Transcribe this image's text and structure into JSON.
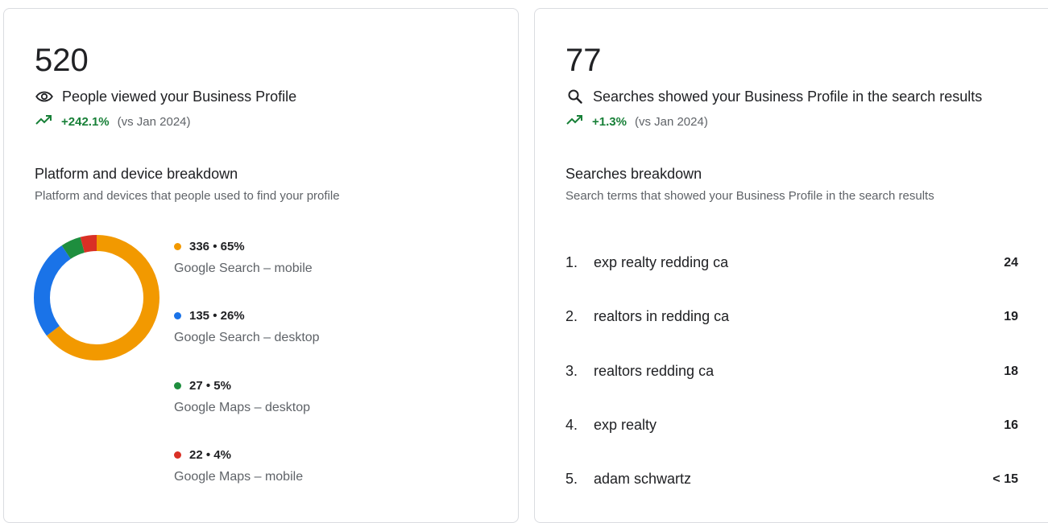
{
  "colors": {
    "mobile_search": "#F29900",
    "desktop_search": "#1A73E8",
    "maps_desktop": "#1E8E3E",
    "maps_mobile": "#D93025",
    "trend_up": "#188038"
  },
  "profile_views": {
    "total": "520",
    "icon": "eye-icon",
    "label": "People viewed your Business Profile",
    "trend_icon": "trending-up-icon",
    "change": "+242.1%",
    "compare": "(vs Jan 2024)",
    "breakdown": {
      "title": "Platform and device breakdown",
      "subtitle": "Platform and devices that people used to find your profile",
      "items": [
        {
          "summary": "336 • 65%",
          "label": "Google Search – mobile",
          "value": 336,
          "color": "#F29900"
        },
        {
          "summary": "135 • 26%",
          "label": "Google Search – desktop",
          "value": 135,
          "color": "#1A73E8"
        },
        {
          "summary": "27 • 5%",
          "label": "Google Maps – desktop",
          "value": 27,
          "color": "#1E8E3E"
        },
        {
          "summary": "22 • 4%",
          "label": "Google Maps – mobile",
          "value": 22,
          "color": "#D93025"
        }
      ]
    }
  },
  "searches": {
    "total": "77",
    "icon": "search-icon",
    "label": "Searches showed your Business Profile in the search results",
    "trend_icon": "trending-up-icon",
    "change": "+1.3%",
    "compare": "(vs Jan 2024)",
    "breakdown": {
      "title": "Searches breakdown",
      "subtitle": "Search terms that showed your Business Profile in the search results",
      "terms": [
        {
          "rank": "1.",
          "term": "exp realty redding ca",
          "count": "24"
        },
        {
          "rank": "2.",
          "term": "realtors in redding ca",
          "count": "19"
        },
        {
          "rank": "3.",
          "term": "realtors redding ca",
          "count": "18"
        },
        {
          "rank": "4.",
          "term": "exp realty",
          "count": "16"
        },
        {
          "rank": "5.",
          "term": "adam schwartz",
          "count": "< 15"
        }
      ]
    }
  }
}
